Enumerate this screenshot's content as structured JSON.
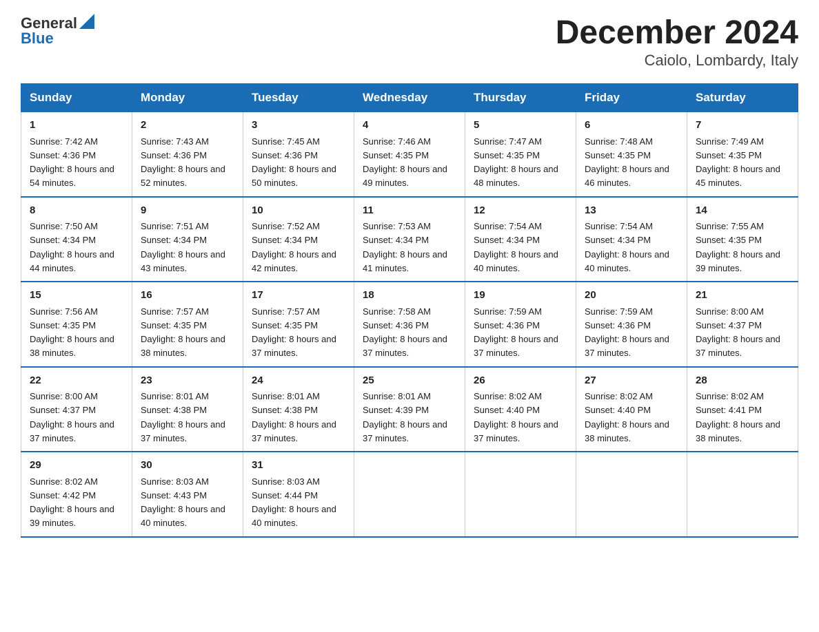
{
  "header": {
    "logo_text": "General",
    "logo_blue": "Blue",
    "title": "December 2024",
    "subtitle": "Caiolo, Lombardy, Italy"
  },
  "days_of_week": [
    "Sunday",
    "Monday",
    "Tuesday",
    "Wednesday",
    "Thursday",
    "Friday",
    "Saturday"
  ],
  "weeks": [
    [
      {
        "day": "1",
        "sunrise": "7:42 AM",
        "sunset": "4:36 PM",
        "daylight": "8 hours and 54 minutes."
      },
      {
        "day": "2",
        "sunrise": "7:43 AM",
        "sunset": "4:36 PM",
        "daylight": "8 hours and 52 minutes."
      },
      {
        "day": "3",
        "sunrise": "7:45 AM",
        "sunset": "4:36 PM",
        "daylight": "8 hours and 50 minutes."
      },
      {
        "day": "4",
        "sunrise": "7:46 AM",
        "sunset": "4:35 PM",
        "daylight": "8 hours and 49 minutes."
      },
      {
        "day": "5",
        "sunrise": "7:47 AM",
        "sunset": "4:35 PM",
        "daylight": "8 hours and 48 minutes."
      },
      {
        "day": "6",
        "sunrise": "7:48 AM",
        "sunset": "4:35 PM",
        "daylight": "8 hours and 46 minutes."
      },
      {
        "day": "7",
        "sunrise": "7:49 AM",
        "sunset": "4:35 PM",
        "daylight": "8 hours and 45 minutes."
      }
    ],
    [
      {
        "day": "8",
        "sunrise": "7:50 AM",
        "sunset": "4:34 PM",
        "daylight": "8 hours and 44 minutes."
      },
      {
        "day": "9",
        "sunrise": "7:51 AM",
        "sunset": "4:34 PM",
        "daylight": "8 hours and 43 minutes."
      },
      {
        "day": "10",
        "sunrise": "7:52 AM",
        "sunset": "4:34 PM",
        "daylight": "8 hours and 42 minutes."
      },
      {
        "day": "11",
        "sunrise": "7:53 AM",
        "sunset": "4:34 PM",
        "daylight": "8 hours and 41 minutes."
      },
      {
        "day": "12",
        "sunrise": "7:54 AM",
        "sunset": "4:34 PM",
        "daylight": "8 hours and 40 minutes."
      },
      {
        "day": "13",
        "sunrise": "7:54 AM",
        "sunset": "4:34 PM",
        "daylight": "8 hours and 40 minutes."
      },
      {
        "day": "14",
        "sunrise": "7:55 AM",
        "sunset": "4:35 PM",
        "daylight": "8 hours and 39 minutes."
      }
    ],
    [
      {
        "day": "15",
        "sunrise": "7:56 AM",
        "sunset": "4:35 PM",
        "daylight": "8 hours and 38 minutes."
      },
      {
        "day": "16",
        "sunrise": "7:57 AM",
        "sunset": "4:35 PM",
        "daylight": "8 hours and 38 minutes."
      },
      {
        "day": "17",
        "sunrise": "7:57 AM",
        "sunset": "4:35 PM",
        "daylight": "8 hours and 37 minutes."
      },
      {
        "day": "18",
        "sunrise": "7:58 AM",
        "sunset": "4:36 PM",
        "daylight": "8 hours and 37 minutes."
      },
      {
        "day": "19",
        "sunrise": "7:59 AM",
        "sunset": "4:36 PM",
        "daylight": "8 hours and 37 minutes."
      },
      {
        "day": "20",
        "sunrise": "7:59 AM",
        "sunset": "4:36 PM",
        "daylight": "8 hours and 37 minutes."
      },
      {
        "day": "21",
        "sunrise": "8:00 AM",
        "sunset": "4:37 PM",
        "daylight": "8 hours and 37 minutes."
      }
    ],
    [
      {
        "day": "22",
        "sunrise": "8:00 AM",
        "sunset": "4:37 PM",
        "daylight": "8 hours and 37 minutes."
      },
      {
        "day": "23",
        "sunrise": "8:01 AM",
        "sunset": "4:38 PM",
        "daylight": "8 hours and 37 minutes."
      },
      {
        "day": "24",
        "sunrise": "8:01 AM",
        "sunset": "4:38 PM",
        "daylight": "8 hours and 37 minutes."
      },
      {
        "day": "25",
        "sunrise": "8:01 AM",
        "sunset": "4:39 PM",
        "daylight": "8 hours and 37 minutes."
      },
      {
        "day": "26",
        "sunrise": "8:02 AM",
        "sunset": "4:40 PM",
        "daylight": "8 hours and 37 minutes."
      },
      {
        "day": "27",
        "sunrise": "8:02 AM",
        "sunset": "4:40 PM",
        "daylight": "8 hours and 38 minutes."
      },
      {
        "day": "28",
        "sunrise": "8:02 AM",
        "sunset": "4:41 PM",
        "daylight": "8 hours and 38 minutes."
      }
    ],
    [
      {
        "day": "29",
        "sunrise": "8:02 AM",
        "sunset": "4:42 PM",
        "daylight": "8 hours and 39 minutes."
      },
      {
        "day": "30",
        "sunrise": "8:03 AM",
        "sunset": "4:43 PM",
        "daylight": "8 hours and 40 minutes."
      },
      {
        "day": "31",
        "sunrise": "8:03 AM",
        "sunset": "4:44 PM",
        "daylight": "8 hours and 40 minutes."
      },
      null,
      null,
      null,
      null
    ]
  ]
}
